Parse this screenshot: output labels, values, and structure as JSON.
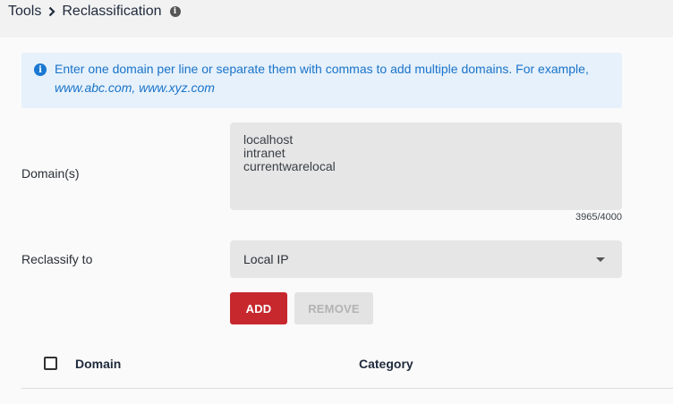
{
  "breadcrumb": {
    "root": "Tools",
    "current": "Reclassification"
  },
  "notice": {
    "text": "Enter one domain per line or separate them with commas to add multiple domains. For example,",
    "example": "www.abc.com, www.xyz.com"
  },
  "form": {
    "domains_label": "Domain(s)",
    "domains_value": "localhost\nintranet\ncurrentwarelocal",
    "char_counter": "3965/4000",
    "reclassify_label": "Reclassify to",
    "reclassify_value": "Local IP"
  },
  "buttons": {
    "add": "ADD",
    "remove": "REMOVE"
  },
  "table": {
    "columns": [
      "Domain",
      "Category"
    ]
  },
  "colors": {
    "add_button": "#c6282e",
    "notice_bg": "#e6f1fb",
    "notice_text": "#1a73c9"
  }
}
